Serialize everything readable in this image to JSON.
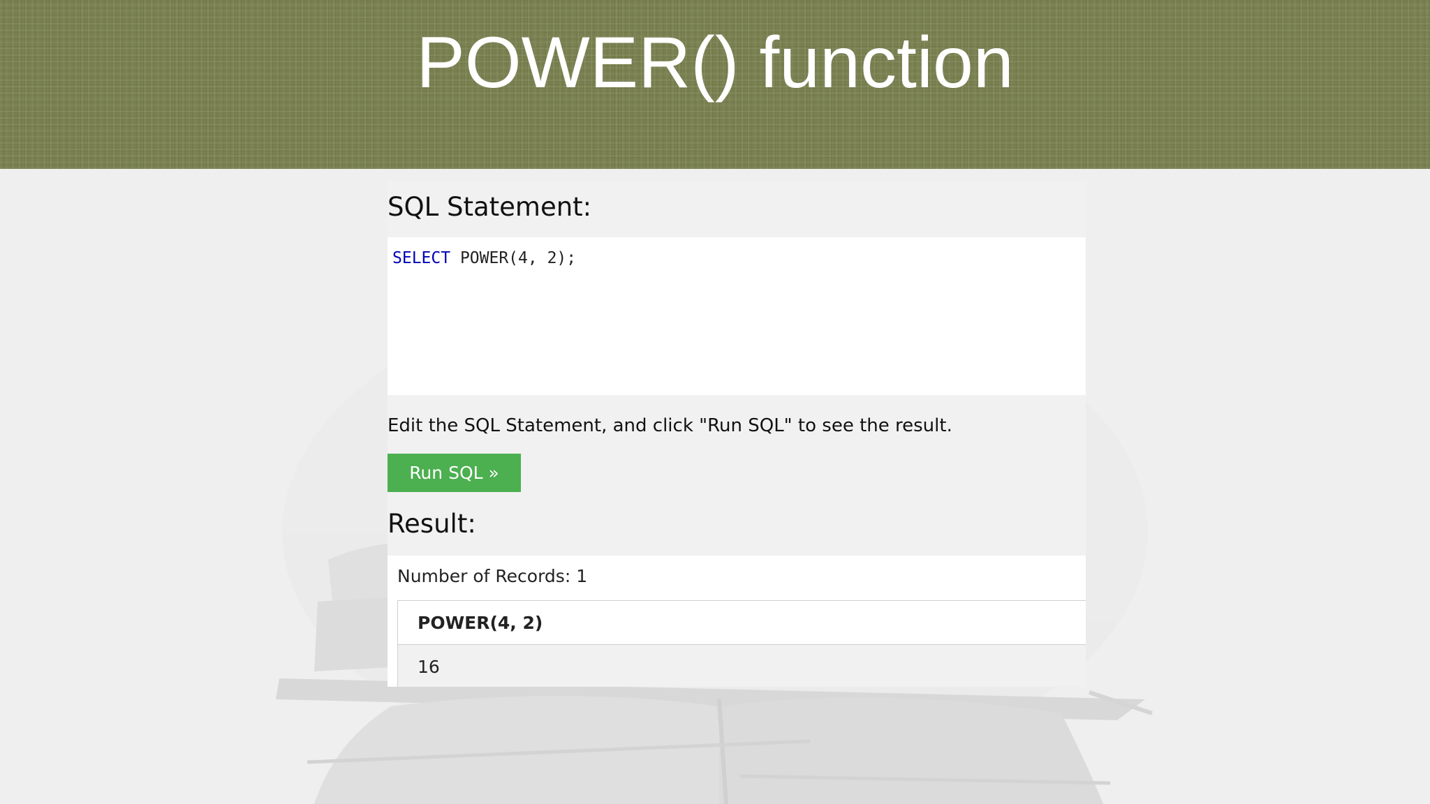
{
  "slide": {
    "title": "POWER() function"
  },
  "tryit": {
    "sql_heading": "SQL Statement:",
    "sql_keyword": "SELECT",
    "sql_rest": " POWER(4, 2);",
    "hint": "Edit the SQL Statement, and click \"Run SQL\" to see the result.",
    "run_button_label": "Run SQL »",
    "result_heading": "Result:",
    "records_label": "Number of Records: 1",
    "table": {
      "columns": [
        "POWER(4, 2)"
      ],
      "rows": [
        [
          "16"
        ]
      ]
    }
  },
  "colors": {
    "banner": "#7a8150",
    "run_button": "#4caf50",
    "sql_keyword": "#0000b8"
  }
}
